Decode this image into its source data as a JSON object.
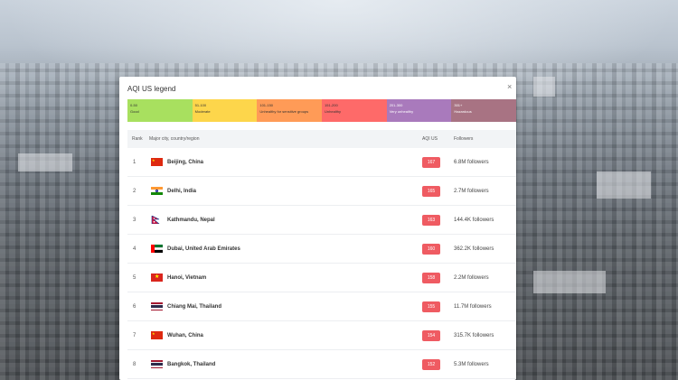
{
  "panel": {
    "title": "AQI US legend",
    "close_glyph": "×"
  },
  "legend": [
    {
      "range": "0-50",
      "label": "Good",
      "color": "#a8e05f"
    },
    {
      "range": "51-100",
      "label": "Moderate",
      "color": "#fdd64b"
    },
    {
      "range": "101-150",
      "label": "Unhealthy for sensitive groups",
      "color": "#ff9b57"
    },
    {
      "range": "151-200",
      "label": "Unhealthy",
      "color": "#fe6a69"
    },
    {
      "range": "201-300",
      "label": "Very unhealthy",
      "color": "#a97abc"
    },
    {
      "range": "301+",
      "label": "Hazardous",
      "color": "#a87383"
    }
  ],
  "table": {
    "headers": {
      "rank": "Rank",
      "city": "Major city, country/region",
      "aqi": "AQI US",
      "followers": "Followers"
    },
    "rows": [
      {
        "rank": "1",
        "city": "Beijing, China",
        "flag": "china-flag-icon",
        "aqi": "167",
        "followers": "6.8M followers"
      },
      {
        "rank": "2",
        "city": "Delhi, India",
        "flag": "india-flag-icon",
        "aqi": "165",
        "followers": "2.7M followers"
      },
      {
        "rank": "3",
        "city": "Kathmandu, Nepal",
        "flag": "nepal-flag-icon",
        "aqi": "163",
        "followers": "144.4K followers"
      },
      {
        "rank": "4",
        "city": "Dubai, United Arab Emirates",
        "flag": "uae-flag-icon",
        "aqi": "160",
        "followers": "362.2K followers"
      },
      {
        "rank": "5",
        "city": "Hanoi, Vietnam",
        "flag": "vietnam-flag-icon",
        "aqi": "158",
        "followers": "2.2M followers"
      },
      {
        "rank": "6",
        "city": "Chiang Mai, Thailand",
        "flag": "thailand-flag-icon",
        "aqi": "155",
        "followers": "11.7M followers"
      },
      {
        "rank": "7",
        "city": "Wuhan, China",
        "flag": "china-flag-icon",
        "aqi": "154",
        "followers": "315.7K followers"
      },
      {
        "rank": "8",
        "city": "Bangkok, Thailand",
        "flag": "thailand-flag-icon",
        "aqi": "152",
        "followers": "5.3M followers"
      }
    ]
  },
  "colors": {
    "aqi_badge": "#ef5b62"
  }
}
